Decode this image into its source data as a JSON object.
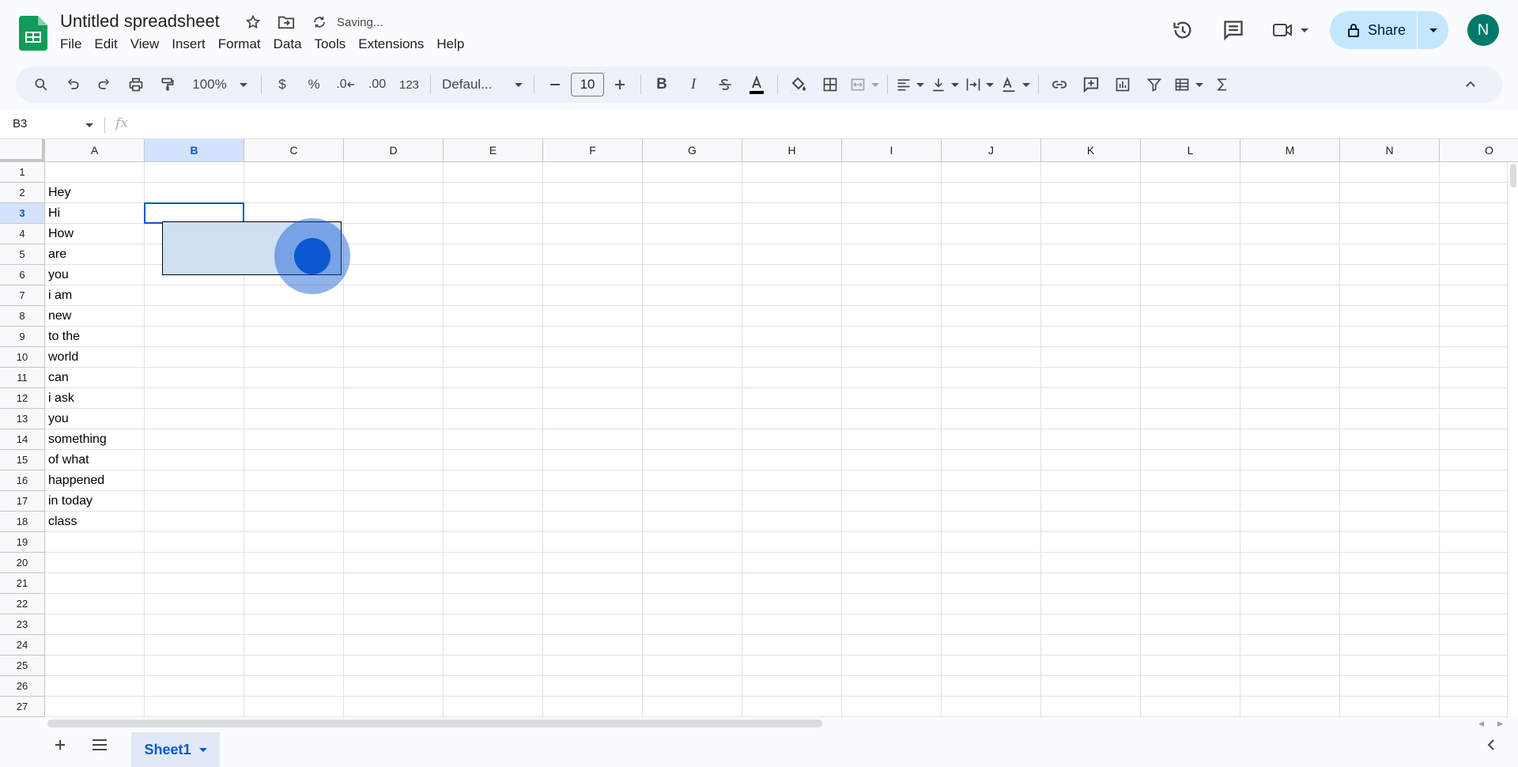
{
  "app": {
    "doc_title": "Untitled spreadsheet",
    "status": "Saving...",
    "share_label": "Share",
    "avatar_initial": "N",
    "accent_color": "#0b57d0",
    "avatar_color": "#00796b"
  },
  "menu": [
    "File",
    "Edit",
    "View",
    "Insert",
    "Format",
    "Data",
    "Tools",
    "Extensions",
    "Help"
  ],
  "toolbar": {
    "zoom": "100%",
    "currency": "$",
    "percent": "%",
    "decrease_decimal": ".0",
    "increase_decimal": ".00",
    "number_format": "123",
    "font": "Defaul...",
    "font_size": "10",
    "bold": "B",
    "italic": "I"
  },
  "formula_bar": {
    "name_box": "B3",
    "fx": "fx",
    "value": ""
  },
  "columns": [
    "A",
    "B",
    "C",
    "D",
    "E",
    "F",
    "G",
    "H",
    "I",
    "J",
    "K",
    "L",
    "M",
    "N",
    "O"
  ],
  "rows": [
    "1",
    "2",
    "3",
    "4",
    "5",
    "6",
    "7",
    "8",
    "9",
    "10",
    "11",
    "12",
    "13",
    "14",
    "15",
    "16",
    "17",
    "18",
    "19",
    "20",
    "21",
    "22",
    "23",
    "24",
    "25",
    "26",
    "27"
  ],
  "cells_colA": [
    "",
    "Hey",
    "Hi",
    "How",
    "are",
    "you",
    "i am",
    "new",
    "to the",
    "world",
    "can",
    "i ask",
    "you",
    "something",
    "of what",
    "happened",
    "in today",
    "class"
  ],
  "selected_cell": "B3",
  "sheet": {
    "tab_name": "Sheet1"
  }
}
